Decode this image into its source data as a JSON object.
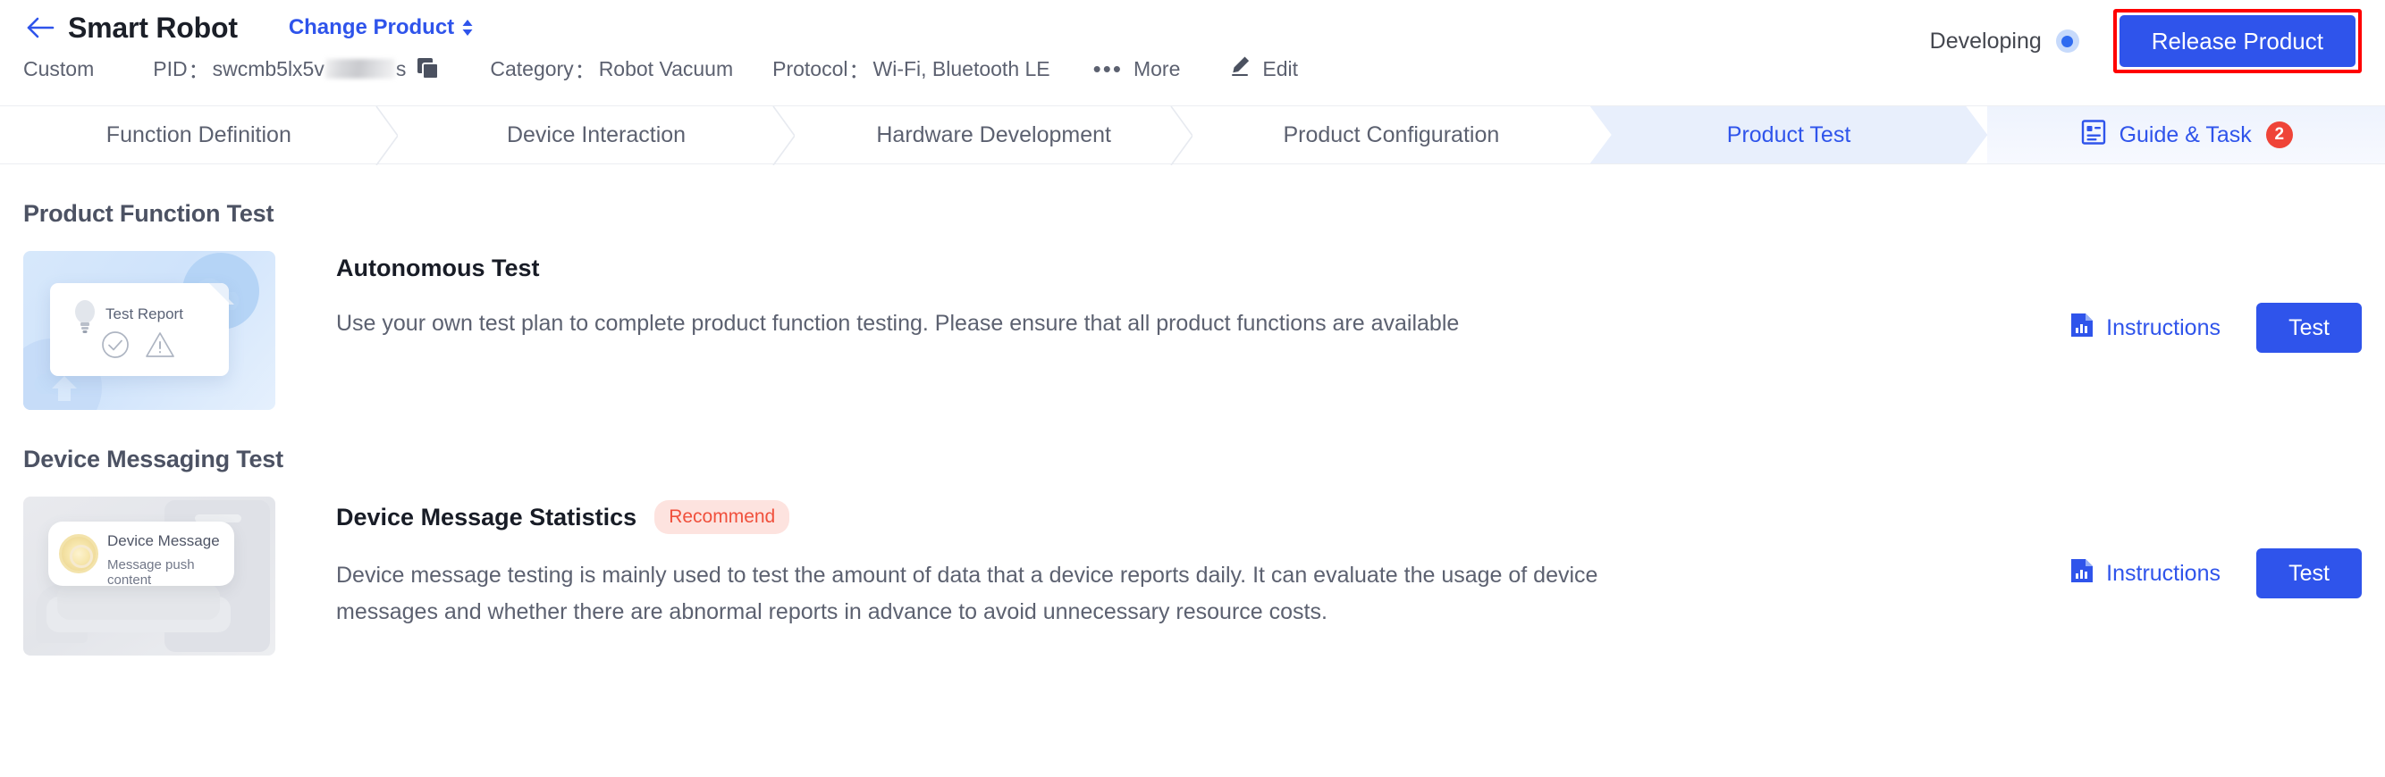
{
  "header": {
    "back_icon": "arrow-left-icon",
    "product_title": "Smart Robot",
    "change_product_label": "Change Product",
    "change_product_icon": "up-down-caret-icon",
    "custom_label": "Custom",
    "pid_label": "PID",
    "pid_value": "swcmb5lx5v",
    "pid_value_suffix": "s",
    "copy_icon": "copy-icon",
    "category_label": "Category",
    "category_value": "Robot Vacuum",
    "protocol_label": "Protocol",
    "protocol_value": "Wi-Fi, Bluetooth LE",
    "more_label": "More",
    "more_icon": "ellipsis-icon",
    "edit_label": "Edit",
    "edit_icon": "pencil-icon",
    "colon": "：",
    "status_label": "Developing",
    "status_dot_color": "#2f6bf0",
    "release_label": "Release Product",
    "release_color": "#2f54eb",
    "highlight_color": "#ff0000"
  },
  "tabs": [
    {
      "label": "Function Definition",
      "active": false
    },
    {
      "label": "Device Interaction",
      "active": false
    },
    {
      "label": "Hardware Development",
      "active": false
    },
    {
      "label": "Product Configuration",
      "active": false
    },
    {
      "label": "Product Test",
      "active": true
    },
    {
      "label": "Guide & Task",
      "active": false,
      "icon": "guide-doc-icon",
      "badge": "2"
    }
  ],
  "sections": [
    {
      "title": "Product Function Test",
      "card": {
        "thumb_icon": "test-report-thumbnail",
        "thumb_text_title": "Test Report",
        "title": "Autonomous Test",
        "badge": null,
        "description": "Use your own test plan to complete product function testing. Please ensure that all product functions are available",
        "instructions_label": "Instructions",
        "instructions_icon": "document-chart-icon",
        "test_label": "Test"
      }
    },
    {
      "title": "Device Messaging Test",
      "card": {
        "thumb_icon": "device-message-thumbnail",
        "thumb_text_title": "Device Message",
        "thumb_text_sub": "Message push content",
        "title": "Device Message Statistics",
        "badge": "Recommend",
        "description": "Device message testing is mainly used to test the amount of data that a device reports daily. It can evaluate the usage of device messages and whether there are abnormal reports in advance to avoid unnecessary resource costs.",
        "instructions_label": "Instructions",
        "instructions_icon": "document-chart-icon",
        "test_label": "Test"
      }
    }
  ]
}
